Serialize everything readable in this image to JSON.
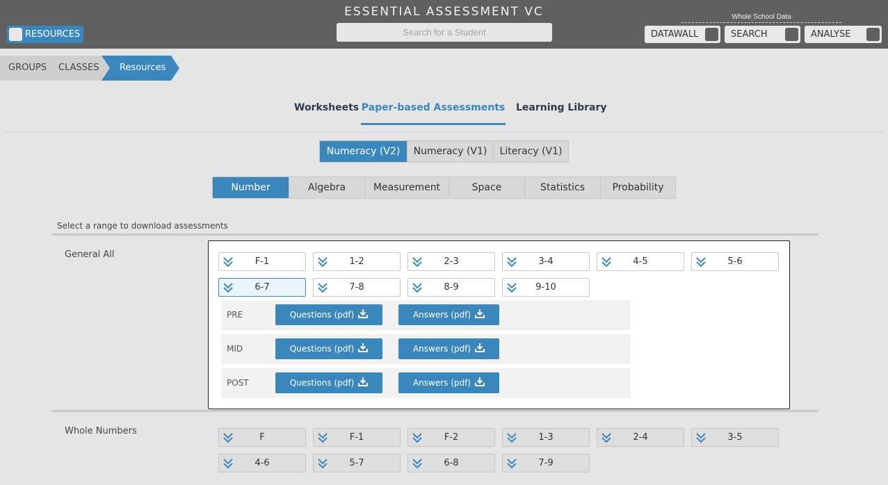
{
  "header": {
    "title": "ESSENTIAL ASSESSMENT VC",
    "search_placeholder": "Search for a Student",
    "resources_label": "RESOURCES",
    "whole_school_label": "Whole School Data",
    "buttons": [
      "DATAWALL",
      "SEARCH",
      "ANALYSE"
    ]
  },
  "breadcrumb": {
    "groups": "GROUPS",
    "classes": "CLASSES",
    "current": "Resources"
  },
  "tabs": {
    "worksheets": "Worksheets",
    "paper": "Paper-based Assessments",
    "library": "Learning Library",
    "active": "Paper-based Assessments"
  },
  "versions": {
    "items": [
      "Numeracy (V2)",
      "Numeracy (V1)",
      "Literacy (V1)"
    ],
    "selected": "Numeracy (V2)"
  },
  "strands": {
    "items": [
      "Number",
      "Algebra",
      "Measurement",
      "Space",
      "Statistics",
      "Probability"
    ],
    "selected": "Number"
  },
  "hint": "Select a range to download assessments",
  "general": {
    "label": "General All",
    "ranges": [
      "F-1",
      "1-2",
      "2-3",
      "3-4",
      "4-5",
      "5-6",
      "6-7",
      "7-8",
      "8-9",
      "9-10"
    ],
    "selected_range": "6-7",
    "downloads": [
      {
        "stage": "PRE",
        "questions": "Questions (pdf)",
        "answers": "Answers (pdf)"
      },
      {
        "stage": "MID",
        "questions": "Questions (pdf)",
        "answers": "Answers (pdf)"
      },
      {
        "stage": "POST",
        "questions": "Questions (pdf)",
        "answers": "Answers (pdf)"
      }
    ]
  },
  "whole_numbers": {
    "label": "Whole Numbers",
    "ranges": [
      "F",
      "F-1",
      "F-2",
      "1-3",
      "2-4",
      "3-5",
      "4-6",
      "5-7",
      "6-8",
      "7-9"
    ]
  },
  "colors": {
    "accent": "#3a87bd",
    "header": "#606060",
    "background": "#e5e5e5"
  },
  "icons": {
    "range_toggle": "double-chevron-down-icon",
    "download": "download-icon"
  }
}
